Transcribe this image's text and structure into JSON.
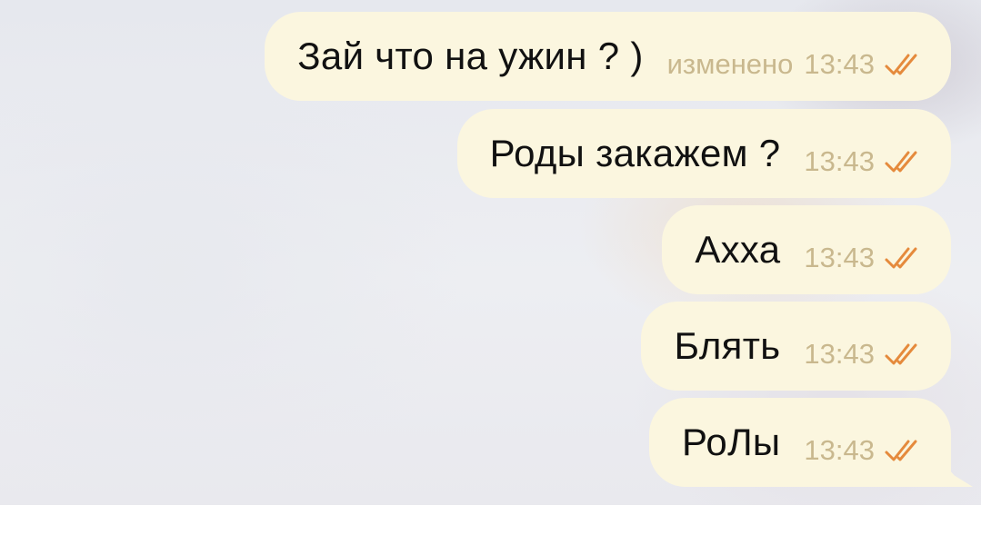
{
  "messages": [
    {
      "text": "Зай что на ужин ? )",
      "edited_label": "изменено",
      "time": "13:43",
      "status_icon": "double-check-icon"
    },
    {
      "text": "Роды закажем ?",
      "edited_label": "",
      "time": "13:43",
      "status_icon": "double-check-icon"
    },
    {
      "text": "Ахха",
      "edited_label": "",
      "time": "13:43",
      "status_icon": "double-check-icon"
    },
    {
      "text": "Блять",
      "edited_label": "",
      "time": "13:43",
      "status_icon": "double-check-icon"
    },
    {
      "text": "РоЛы",
      "edited_label": "",
      "time": "13:43",
      "status_icon": "double-check-icon"
    }
  ],
  "colors": {
    "bubble": "#fbf6df",
    "text": "#111111",
    "meta": "#c9b88e",
    "checks": "#e58a3c"
  }
}
